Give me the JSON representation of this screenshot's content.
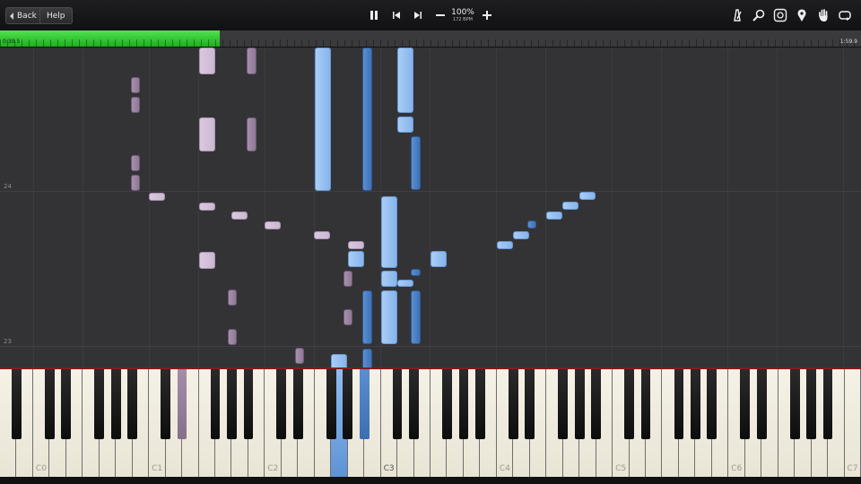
{
  "toolbar": {
    "back_label": "Back",
    "help_label": "Help",
    "tempo_percent": "100%",
    "tempo_bpm": "172 BPM",
    "icons": {
      "pause": "pause-icon",
      "previous": "skip-back-icon",
      "next": "skip-forward-icon",
      "slower": "minus-icon",
      "faster": "plus-icon",
      "metronome": "metronome-icon",
      "zoom": "magnifier-icon",
      "track_settings": "track-settings-icon",
      "marker": "location-pin-icon",
      "hand": "hand-icon",
      "loop": "loop-icon"
    }
  },
  "progress": {
    "current_time": "0:30.5",
    "total_time": "1:59.9",
    "fraction": 0.255,
    "fill_color": "#2fcf2f"
  },
  "roll": {
    "measure_labels": [
      "24",
      "23"
    ],
    "note_colors": {
      "left_hand_light": "#d2c1d8",
      "left_hand_dark": "#9a83a1",
      "right_hand_light": "#97c1f2",
      "right_hand_dark": "#4b80c3"
    }
  },
  "keyboard": {
    "octave_labels": [
      "C0",
      "C1",
      "C2",
      "C3",
      "C4",
      "C5",
      "C6",
      "C7"
    ],
    "highlighted_octave_label": "C3"
  }
}
